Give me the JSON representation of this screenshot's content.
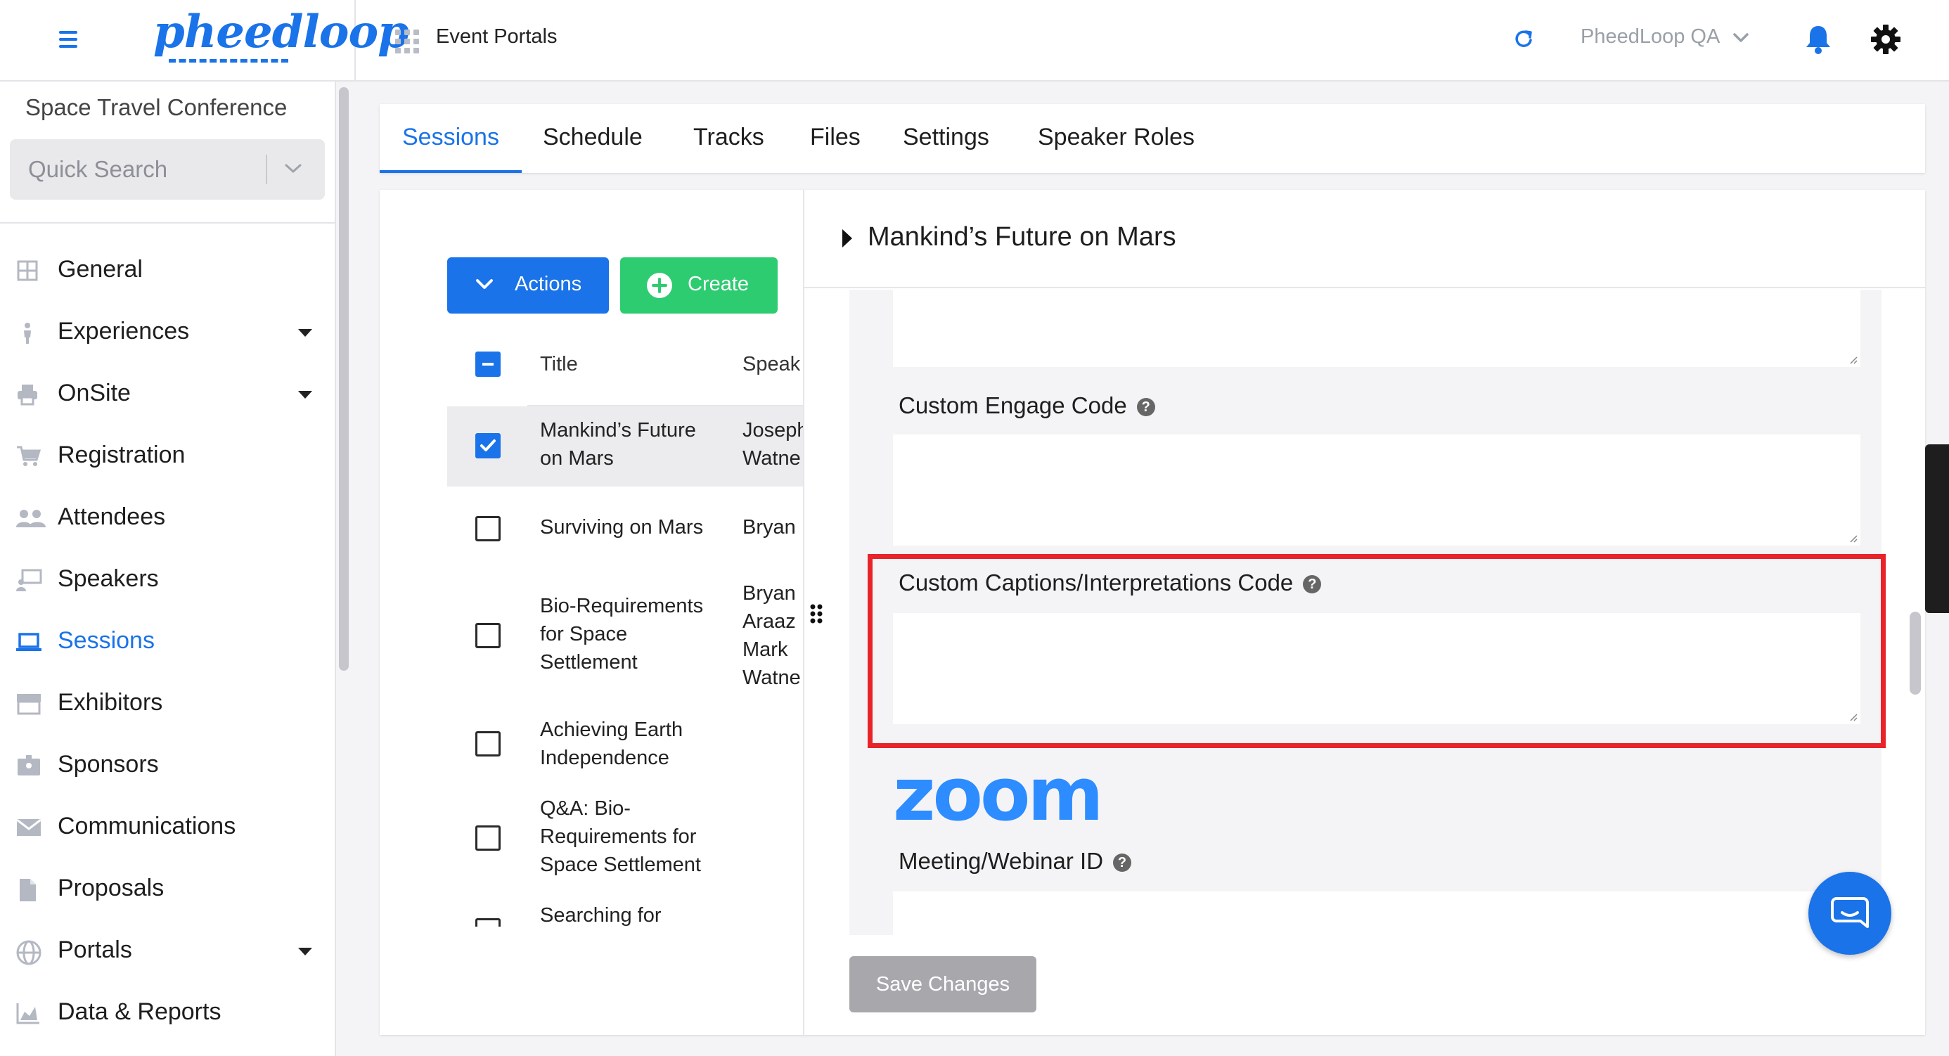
{
  "app": {
    "brand": "pheedloop",
    "header_title": "Event Portals",
    "account": "PheedLoop QA"
  },
  "sidebar": {
    "event_name": "Space Travel Conference",
    "search_placeholder": "Quick Search",
    "items": [
      {
        "label": "General",
        "icon": "grid-icon"
      },
      {
        "label": "Experiences",
        "icon": "person-icon",
        "expandable": true
      },
      {
        "label": "OnSite",
        "icon": "printer-icon",
        "expandable": true
      },
      {
        "label": "Registration",
        "icon": "cart-icon"
      },
      {
        "label": "Attendees",
        "icon": "people-icon"
      },
      {
        "label": "Speakers",
        "icon": "presenter-icon"
      },
      {
        "label": "Sessions",
        "icon": "laptop-icon",
        "active": true
      },
      {
        "label": "Exhibitors",
        "icon": "store-icon"
      },
      {
        "label": "Sponsors",
        "icon": "badge-icon"
      },
      {
        "label": "Communications",
        "icon": "mail-icon"
      },
      {
        "label": "Proposals",
        "icon": "document-icon"
      },
      {
        "label": "Portals",
        "icon": "globe-icon",
        "expandable": true
      },
      {
        "label": "Data & Reports",
        "icon": "chart-icon"
      }
    ]
  },
  "tabs": [
    "Sessions",
    "Schedule",
    "Tracks",
    "Files",
    "Settings",
    "Speaker Roles"
  ],
  "list": {
    "actions_label": "Actions",
    "create_label": "Create",
    "columns": [
      "Title",
      "Speak"
    ],
    "rows": [
      {
        "title": "Mankind’s Future on Mars",
        "speaker": "Joseph Watne",
        "checked": true
      },
      {
        "title": "Surviving on Mars",
        "speaker": "Bryan",
        "checked": false
      },
      {
        "title": "Bio-Requirements for Space Settlement",
        "speaker": "Bryan Araaz Mark Watne",
        "checked": false
      },
      {
        "title": "Achieving Earth Independence",
        "speaker": "",
        "checked": false
      },
      {
        "title": "Q&A: Bio-Requirements for Space Settlement",
        "speaker": "",
        "checked": false
      },
      {
        "title": "Searching for",
        "speaker": "",
        "checked": false
      }
    ]
  },
  "detail": {
    "session_title": "Mankind’s Future on Mars",
    "fields": {
      "engage_label": "Custom Engage Code",
      "captions_label": "Custom Captions/Interpretations Code",
      "zoom_logo": "zoom",
      "meeting_label": "Meeting/Webinar ID"
    },
    "save_label": "Save Changes"
  },
  "colors": {
    "accent": "#1a73e8",
    "create": "#2ecc71",
    "highlight": "#e8232a",
    "zoom": "#2d8cff"
  }
}
